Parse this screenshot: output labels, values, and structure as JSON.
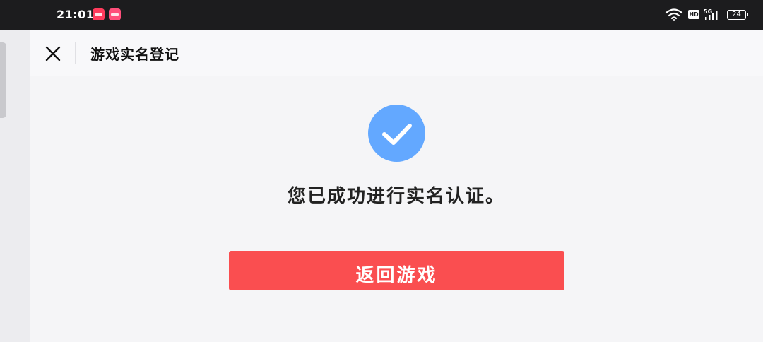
{
  "status_bar": {
    "time": "21:01",
    "network_badge": "HD",
    "signal_label": "5G",
    "battery": "24",
    "icons": [
      "app-notification-icon",
      "app-notification-icon",
      "wifi-icon",
      "hd-icon",
      "signal-5g-icon",
      "battery-icon"
    ]
  },
  "header": {
    "title": "游戏实名登记",
    "close_icon": "close-icon"
  },
  "main": {
    "status_icon": "checkmark-icon",
    "message": "您已成功进行实名认证。",
    "return_button_label": "返回游戏"
  },
  "colors": {
    "accent_blue": "#63a8ff",
    "button_red": "#fa4e50",
    "status_bar_bg": "#1c1c1e",
    "page_bg": "#f5f5f7"
  }
}
